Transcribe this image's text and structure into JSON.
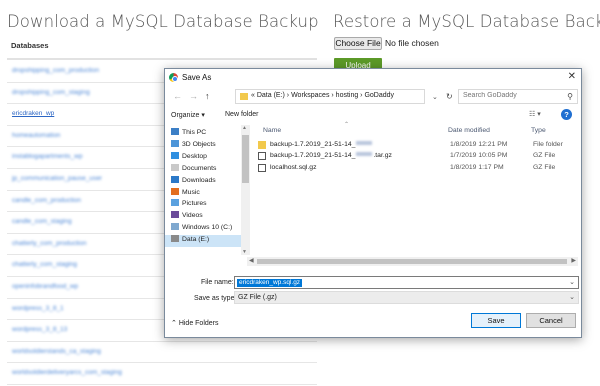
{
  "page": {
    "download_heading": "Download a MySQL Database Backup",
    "restore_heading": "Restore a MySQL Database Backup",
    "databases_header": "Databases",
    "databases": [
      {
        "label": "dropshipping_com_production",
        "obscured": true
      },
      {
        "label": "dropshipping_com_staging",
        "obscured": true
      },
      {
        "label": "ericdraken_wp",
        "obscured": false
      },
      {
        "label": "homeautomation",
        "obscured": true
      },
      {
        "label": "instablogapartments_wp",
        "obscured": true
      },
      {
        "label": "jp_communication_pause_user",
        "obscured": true
      },
      {
        "label": "candle_com_production",
        "obscured": true
      },
      {
        "label": "candle_com_staging",
        "obscured": true
      },
      {
        "label": "chatterly_com_production",
        "obscured": true
      },
      {
        "label": "chatterly_com_staging",
        "obscured": true
      },
      {
        "label": "openinfobrandfood_wp",
        "obscured": true
      },
      {
        "label": "wordpress_3_8_1",
        "obscured": true
      },
      {
        "label": "wordpress_3_8_13",
        "obscured": true
      },
      {
        "label": "worldsoldierstands_ca_staging",
        "obscured": true
      },
      {
        "label": "worldsoldierdeliveryarcs_com_staging",
        "obscured": true
      }
    ],
    "choose_file_label": "Choose File",
    "no_file_text": "No file chosen",
    "upload_label": "Upload"
  },
  "dialog": {
    "title": "Save As",
    "close_glyph": "✕",
    "nav": {
      "back": "←",
      "forward": "→",
      "up": "↑",
      "refresh": "↻"
    },
    "address": "« Data (E:) › Workspaces › hosting › GoDaddy",
    "search_placeholder": "Search GoDaddy",
    "toolbar": {
      "organize": "Organize ▾",
      "new_folder": "New folder",
      "view": "☷ ▾",
      "help": "?"
    },
    "tree": [
      {
        "label": "This PC",
        "icon_color": "#3c7fc6",
        "selected": false
      },
      {
        "label": "3D Objects",
        "icon_color": "#4c95d8",
        "selected": false
      },
      {
        "label": "Desktop",
        "icon_color": "#2f8fe0",
        "selected": false
      },
      {
        "label": "Documents",
        "icon_color": "#c9c9c9",
        "selected": false
      },
      {
        "label": "Downloads",
        "icon_color": "#2b79c8",
        "selected": false
      },
      {
        "label": "Music",
        "icon_color": "#e36e1e",
        "selected": false
      },
      {
        "label": "Pictures",
        "icon_color": "#5aa1df",
        "selected": false
      },
      {
        "label": "Videos",
        "icon_color": "#6b4b9a",
        "selected": false
      },
      {
        "label": "Windows 10 (C:)",
        "icon_color": "#7fa8cf",
        "selected": false
      },
      {
        "label": "Data (E:)",
        "icon_color": "#8a8a8a",
        "selected": true
      }
    ],
    "columns": {
      "name": "Name",
      "date": "Date modified",
      "type": "Type"
    },
    "files": [
      {
        "name_pre": "backup-1.7.2019_21-51-14_",
        "name_post": "",
        "date": "1/8/2019 12:21 PM",
        "type": "File folder",
        "icon": "folder"
      },
      {
        "name_pre": "backup-1.7.2019_21-51-14_",
        "name_post": ".tar.gz",
        "date": "1/7/2019 10:05 PM",
        "type": "GZ File",
        "icon": "doc"
      },
      {
        "name_pre": "localhost.sql.gz",
        "name_post": "",
        "date": "1/8/2019 1:17 PM",
        "type": "GZ File",
        "icon": "doc"
      }
    ],
    "file_name_label": "File name:",
    "file_name_value": "ericdraken_wp.sql.gz",
    "save_as_type_label": "Save as type:",
    "save_as_type_value": "GZ File (.gz)",
    "hide_folders": "Hide Folders",
    "save_label": "Save",
    "cancel_label": "Cancel"
  }
}
